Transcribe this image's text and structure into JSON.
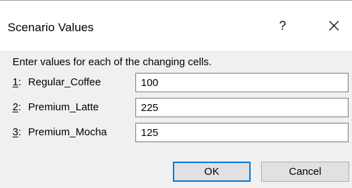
{
  "window": {
    "title": "Scenario Values",
    "help_glyph": "?",
    "close_icon": "close-icon"
  },
  "prompt": "Enter values for each of the changing cells.",
  "cells": [
    {
      "num": "1",
      "name": "Regular_Coffee",
      "value": "100"
    },
    {
      "num": "2",
      "name": "Premium_Latte",
      "value": "225"
    },
    {
      "num": "3",
      "name": "Premium_Mocha",
      "value": "125"
    }
  ],
  "buttons": {
    "ok_label": "OK",
    "cancel_label": "Cancel"
  },
  "colors": {
    "accent": "#0078d7",
    "dialog_background": "#f0f0f0",
    "titlebar_background": "#ffffff"
  }
}
